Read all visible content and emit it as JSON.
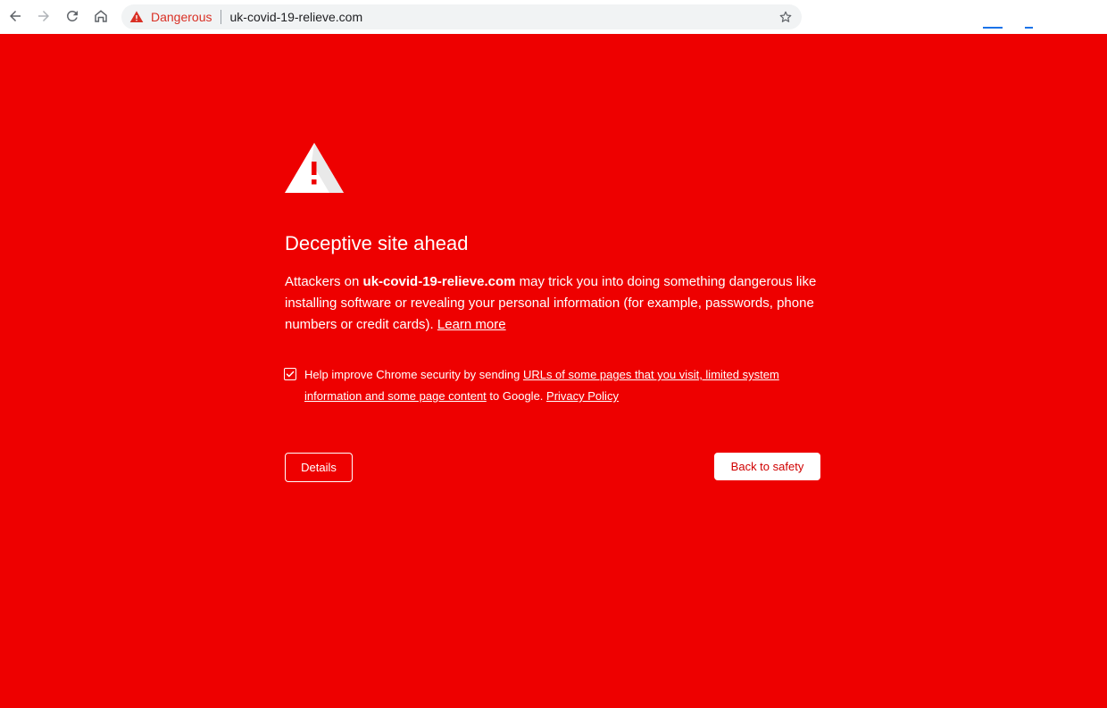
{
  "browser": {
    "security_chip": {
      "label": "Dangerous",
      "icon": "warning-triangle-icon",
      "color": "#d93025"
    },
    "url": "uk-covid-19-relieve.com",
    "nav_icons": [
      "back-icon",
      "forward-icon",
      "reload-icon",
      "home-icon"
    ],
    "bookmark_icon": "star-icon"
  },
  "interstitial": {
    "background_color": "#ee0000",
    "heading": "Deceptive site ahead",
    "message": {
      "prefix": "Attackers on ",
      "domain": "uk-covid-19-relieve.com",
      "suffix": " may trick you into doing something dangerous like installing software or revealing your personal information (for example, passwords, phone numbers or credit cards). ",
      "learn_more": "Learn more"
    },
    "optin": {
      "checked": true,
      "prefix": "Help improve Chrome security by sending ",
      "link": "URLs of some pages that you visit, limited system information and some page content",
      "middle": " to Google. ",
      "privacy_link": "Privacy Policy"
    },
    "details_button": "Details",
    "back_button": "Back to safety"
  }
}
